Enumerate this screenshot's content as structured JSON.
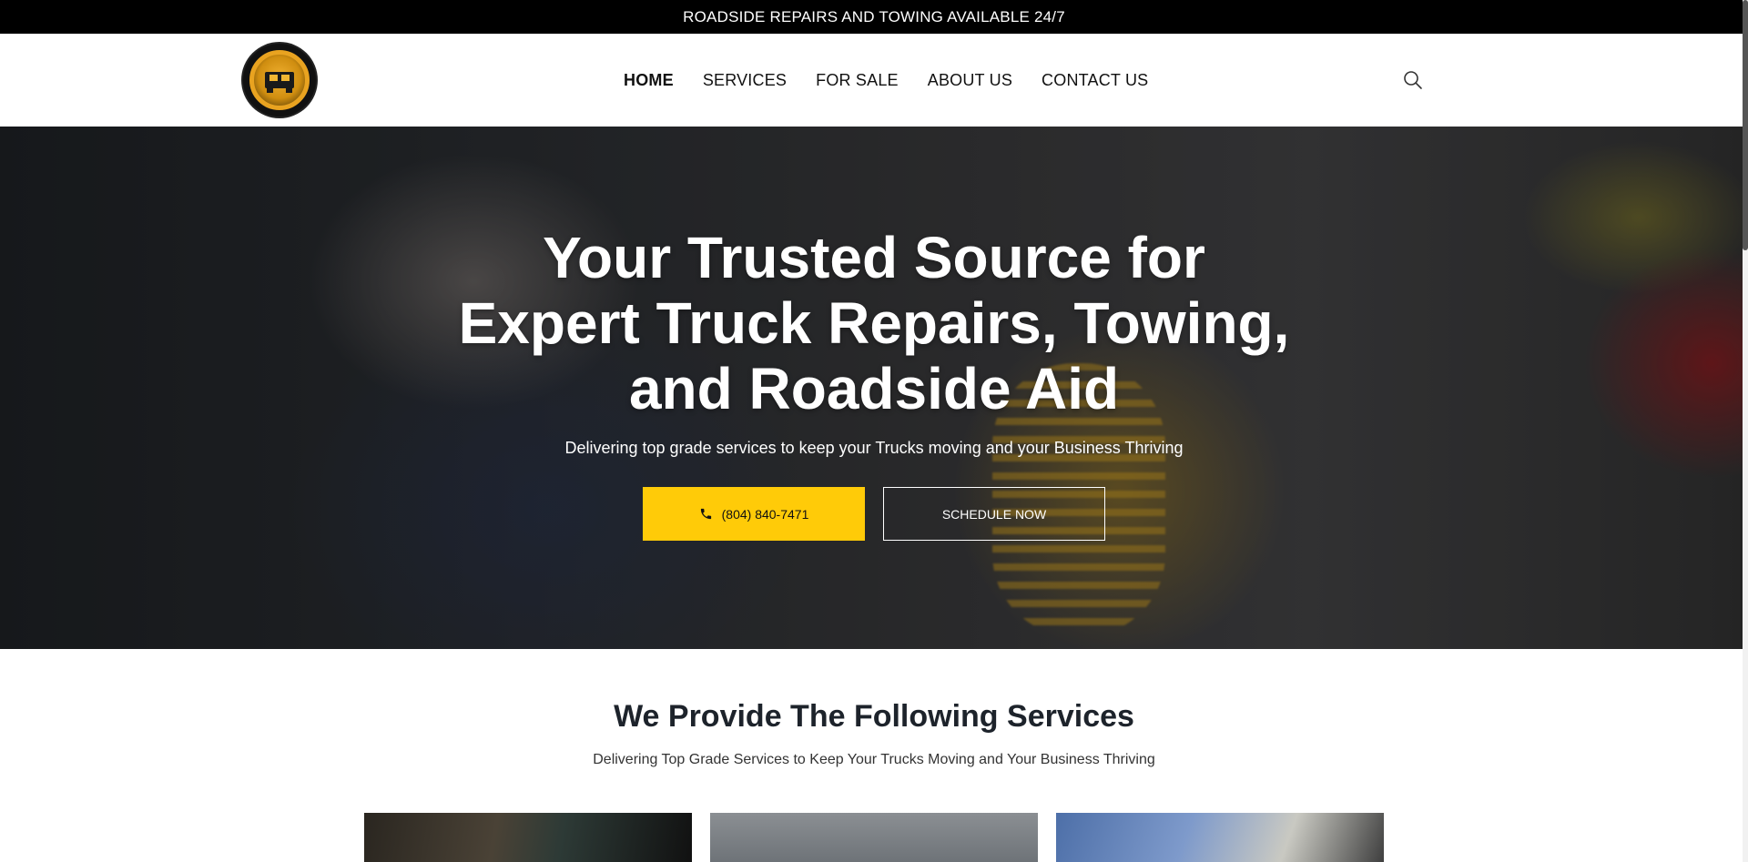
{
  "topbar": {
    "text": "ROADSIDE REPAIRS AND TOWING AVAILABLE 24/7"
  },
  "header": {
    "logo_icon": "truck-badge-logo",
    "nav": [
      {
        "label": "HOME",
        "active": true
      },
      {
        "label": "SERVICES",
        "active": false
      },
      {
        "label": "FOR SALE",
        "active": false
      },
      {
        "label": "ABOUT US",
        "active": false
      },
      {
        "label": "CONTACT US",
        "active": false
      }
    ],
    "search_icon": "search-icon"
  },
  "hero": {
    "title_lines": [
      "Your Trusted Source for",
      "Expert Truck Repairs, Towing,",
      "and Roadside Aid"
    ],
    "subtitle": "Delivering top grade services to keep your Trucks moving and your Business Thriving",
    "call_button": {
      "label": "(804) 840-7471",
      "icon": "phone-icon"
    },
    "schedule_button": {
      "label": "SCHEDULE NOW"
    }
  },
  "services": {
    "title": "We Provide The Following Services",
    "subtitle": "Delivering Top Grade Services to Keep Your Trucks Moving and Your Business Thriving"
  },
  "colors": {
    "accent": "#ffcb08",
    "topbar_bg": "#000000",
    "heading": "#1d232b"
  }
}
